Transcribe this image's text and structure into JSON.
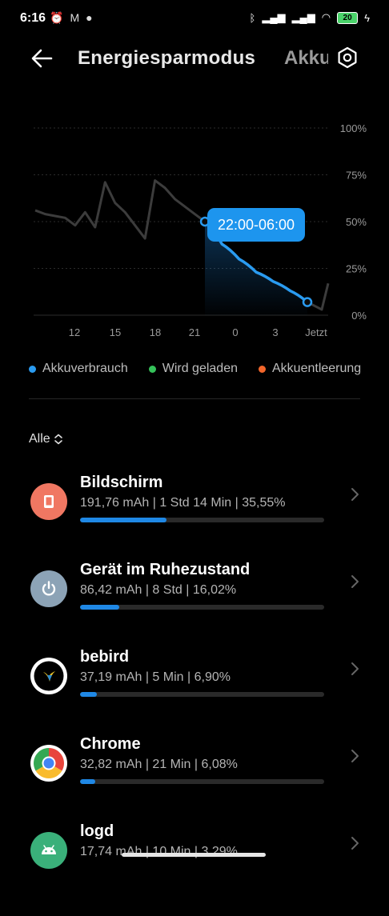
{
  "status_bar": {
    "time": "6:16",
    "battery": "20"
  },
  "header": {
    "title": "Energiesparmodus",
    "next_tab": "Akku"
  },
  "chart_data": {
    "type": "line",
    "x_ticks": [
      "12",
      "15",
      "18",
      "21",
      "0",
      "3",
      "Jetzt"
    ],
    "y_ticks": [
      "100%",
      "75%",
      "50%",
      "25%",
      "0%"
    ],
    "ylim": [
      0,
      100
    ],
    "tooltip": "22:00-06:00",
    "series": [
      {
        "name": "Akkuverbrauch",
        "color": "#2a9bf0"
      }
    ],
    "history_values": [
      56,
      54,
      53,
      52,
      48,
      55,
      47,
      71,
      60,
      55,
      48,
      41,
      72,
      68,
      62,
      58,
      54,
      50
    ],
    "selected_values": [
      50,
      38,
      30,
      23,
      18,
      13,
      7
    ],
    "tail_values": [
      7,
      3,
      17
    ]
  },
  "legend": [
    {
      "label": "Akkuverbrauch",
      "color": "#2a9bf0"
    },
    {
      "label": "Wird geladen",
      "color": "#35c25a"
    },
    {
      "label": "Akkuentleerung",
      "color": "#f2662b"
    }
  ],
  "filter": {
    "label": "Alle"
  },
  "items": [
    {
      "name": "Bildschirm",
      "detail": "191,76 mAh | 1 Std 14 Min  | 35,55%",
      "percent": 35.55,
      "icon": "screen-icon"
    },
    {
      "name": "Gerät im Ruhezustand",
      "detail": "86,42 mAh | 8 Std  | 16,02%",
      "percent": 16.02,
      "icon": "power-icon"
    },
    {
      "name": "bebird",
      "detail": "37,19 mAh | 5 Min  | 6,90%",
      "percent": 6.9,
      "icon": "bebird-icon"
    },
    {
      "name": "Chrome",
      "detail": "32,82 mAh | 21 Min  | 6,08%",
      "percent": 6.08,
      "icon": "chrome-icon"
    },
    {
      "name": "logd",
      "detail": "17,74 mAh | 10 Min  | 3,29%",
      "percent": 3.29,
      "icon": "android-icon"
    }
  ]
}
